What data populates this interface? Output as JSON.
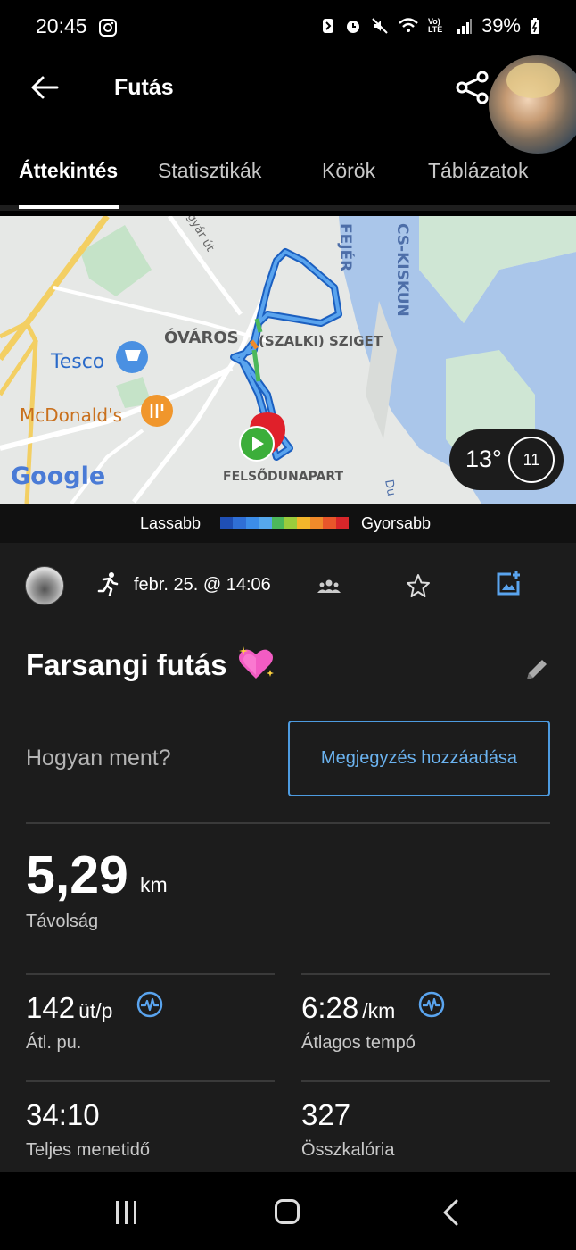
{
  "status_bar": {
    "time": "20:45",
    "signal_text": "Vo) LTE",
    "battery": "39%"
  },
  "app_bar": {
    "title": "Futás"
  },
  "tabs": [
    {
      "label": "Áttekintés",
      "active": true
    },
    {
      "label": "Statisztikák",
      "active": false
    },
    {
      "label": "Körök",
      "active": false
    },
    {
      "label": "Táblázatok",
      "active": false
    }
  ],
  "map": {
    "labels": {
      "ovaros": "ÓVÁROS",
      "sziget": "(SZALKI) SZIGET",
      "tesco": "Tesco",
      "mcdonalds": "McDonald's",
      "felsodunapart": "FELSŐDUNAPART",
      "fejer": "FEJÉR",
      "bacs_kiskun": "CS-KISKUN",
      "gyar_ut": "gyár út",
      "duna": "Du",
      "google": "Google"
    },
    "weather": {
      "temperature": "13°",
      "wind": "11"
    }
  },
  "legend": {
    "slower": "Lassabb",
    "faster": "Gyorsabb",
    "colors": [
      "#1f4fb5",
      "#2f6fd6",
      "#3c8de8",
      "#56a8ec",
      "#4cb85b",
      "#9bcc3c",
      "#f3b62b",
      "#f08a2a",
      "#e8562a",
      "#d8262a"
    ]
  },
  "activity": {
    "date": "febr. 25. @ 14:06",
    "title": "Farsangi futás",
    "how_label": "Hogyan ment?",
    "note_button": "Megjegyzés hozzáadása",
    "distance": {
      "value": "5,29",
      "unit": "km",
      "label": "Távolság"
    },
    "avg_hr": {
      "value": "142",
      "unit": "üt/p",
      "label": "Átl. pu."
    },
    "avg_pace": {
      "value": "6:28",
      "unit": "/km",
      "label": "Átlagos tempó"
    },
    "total_time": {
      "value": "34:10",
      "label": "Teljes menetidő"
    },
    "calories": {
      "value": "327",
      "label": "Összkalória"
    }
  },
  "colors": {
    "accent": "#4d9be0",
    "background": "#1c1c1c"
  }
}
